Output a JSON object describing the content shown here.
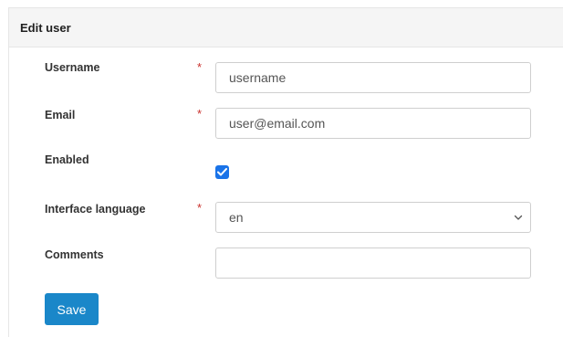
{
  "panel": {
    "title": "Edit user"
  },
  "form": {
    "username": {
      "label": "Username",
      "required_mark": "*",
      "value": "username"
    },
    "email": {
      "label": "Email",
      "required_mark": "*",
      "value": "user@email.com"
    },
    "enabled": {
      "label": "Enabled",
      "checked": true
    },
    "interface_language": {
      "label": "Interface language",
      "required_mark": "*",
      "selected": "en"
    },
    "comments": {
      "label": "Comments",
      "value": ""
    },
    "save_label": "Save"
  },
  "colors": {
    "required": "#c9302c",
    "checkbox": "#1a73e8",
    "save_button": "#1a87c9",
    "header_bg": "#f5f5f5"
  },
  "icons": {
    "checkbox": "check-icon",
    "select": "chevron-down-icon"
  }
}
